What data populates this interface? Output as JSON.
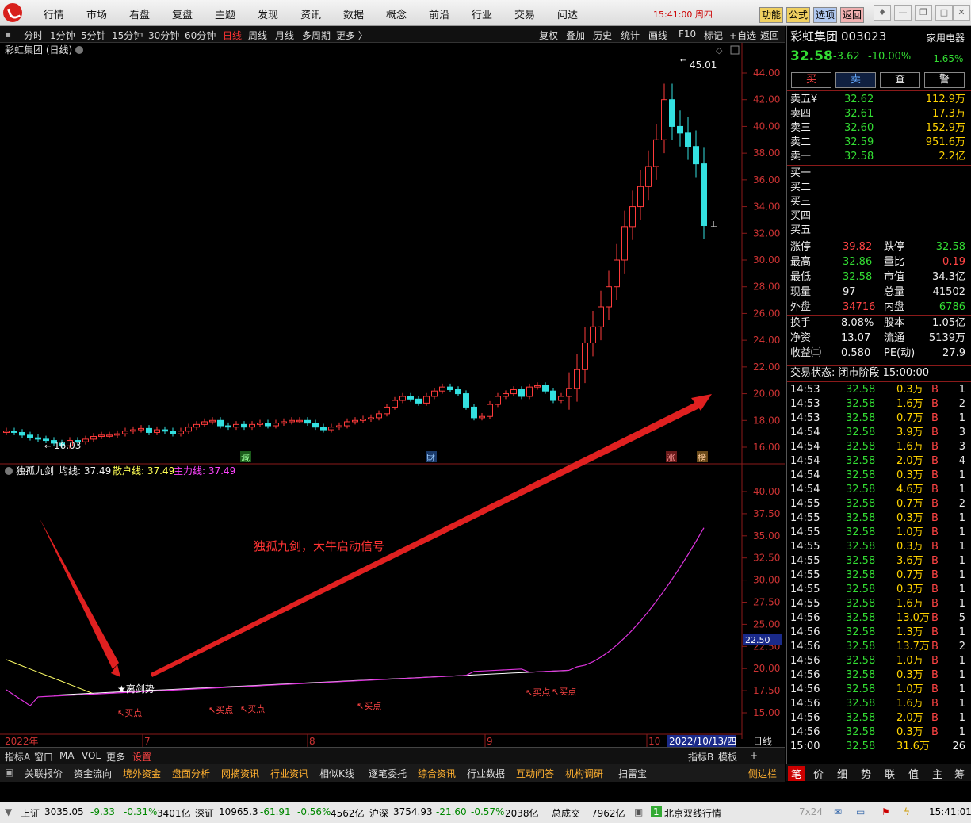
{
  "menu": [
    "行情",
    "市场",
    "看盘",
    "复盘",
    "主题",
    "发现",
    "资讯",
    "数据",
    "概念",
    "前沿",
    "行业",
    "交易",
    "问达"
  ],
  "clock": "15:41:00 周四",
  "top_buttons": [
    "功能",
    "公式",
    "选项",
    "返回"
  ],
  "periods": [
    "分时",
    "1分钟",
    "5分钟",
    "15分钟",
    "30分钟",
    "60分钟",
    "日线",
    "周线",
    "月线",
    "多周期",
    "更多 〉"
  ],
  "tools": [
    "复权",
    "叠加",
    "历史",
    "统计",
    "画线",
    "F10",
    "标记",
    "+自选",
    "返回"
  ],
  "chart": {
    "title": "彩虹集团 (日线)",
    "high_label": "45.01",
    "low_label": "16.03",
    "price_ticks": [
      "44.00",
      "42.00",
      "40.00",
      "38.00",
      "36.00",
      "34.00",
      "32.00",
      "30.00",
      "28.00",
      "26.00",
      "24.00",
      "22.00",
      "20.00",
      "18.00",
      "16.00"
    ],
    "event_markers": [
      "減",
      "財",
      "涨",
      "榜"
    ],
    "indicator_title": "独孤九剑",
    "indicator_legend": "均线: 37.49",
    "indicator_legend2": "散户线: 37.49",
    "indicator_legend3": "主力线: 37.49",
    "ind_ticks": [
      "40.00",
      "37.50",
      "35.00",
      "32.50",
      "30.00",
      "27.50",
      "25.00",
      "22.50",
      "20.00",
      "17.50",
      "15.00"
    ],
    "current_value_tag": "22.50",
    "annotation": "独孤九剑，大牛启动信号",
    "signal_label": "★离剑势",
    "buy_points": [
      "买点",
      "买点",
      "买点",
      "买点",
      "买点",
      "买点"
    ],
    "x_labels": [
      "2022年",
      "7",
      "8",
      "9",
      "10"
    ],
    "date_label": "2022/10/13/四",
    "period_label": "日线"
  },
  "chart_data": {
    "type": "candlestick",
    "title": "彩虹集团 (日线)",
    "high": 45.01,
    "low": 16.03,
    "close_values": [
      17.2,
      17.1,
      16.9,
      16.7,
      16.6,
      16.5,
      16.3,
      16.1,
      16.5,
      16.4,
      16.6,
      16.8,
      16.9,
      16.9,
      17.0,
      17.2,
      17.3,
      17.4,
      17.1,
      17.3,
      17.2,
      17.0,
      17.2,
      17.5,
      17.7,
      17.9,
      18.0,
      17.6,
      17.5,
      17.7,
      17.5,
      17.7,
      17.8,
      17.6,
      17.8,
      17.9,
      18.0,
      18.0,
      17.8,
      17.5,
      17.3,
      17.5,
      17.6,
      17.9,
      18.0,
      18.1,
      18.2,
      18.5,
      19.0,
      19.5,
      19.8,
      19.6,
      19.3,
      19.8,
      20.2,
      20.5,
      20.3,
      20.0,
      19.0,
      18.2,
      18.3,
      19.2,
      19.8,
      20.0,
      20.3,
      19.8,
      20.5,
      20.6,
      20.2,
      19.5,
      19.8,
      20.4,
      21.8,
      23.8,
      25.0,
      26.5,
      28.0,
      30.0,
      32.5,
      34.0,
      35.5,
      37.0,
      39.0,
      42.0,
      40.0,
      39.5,
      38.5,
      37.2,
      32.58
    ],
    "indicator_series": [
      {
        "name": "均线",
        "value": 37.49
      },
      {
        "name": "散户线",
        "value": 37.49
      },
      {
        "name": "主力线",
        "value": 37.49
      }
    ],
    "ylim": [
      15,
      45
    ]
  },
  "quote": {
    "name": "彩虹集团",
    "code": "003023",
    "sector": "家用电器",
    "price": "32.58",
    "change": "-3.62",
    "pct": "-10.00%",
    "sector_pct": "-1.65%",
    "trade_buttons": [
      "买",
      "卖",
      "查",
      "警"
    ],
    "asks": [
      {
        "label": "卖五¥",
        "price": "32.62",
        "vol": "112.9万"
      },
      {
        "label": "卖四",
        "price": "32.61",
        "vol": "17.3万"
      },
      {
        "label": "卖三",
        "price": "32.60",
        "vol": "152.9万"
      },
      {
        "label": "卖二",
        "price": "32.59",
        "vol": "951.6万"
      },
      {
        "label": "卖一",
        "price": "32.58",
        "vol": "2.2亿"
      }
    ],
    "bids": [
      "买一",
      "买二",
      "买三",
      "买四",
      "买五"
    ],
    "stats": [
      {
        "k1": "涨停",
        "v1": "39.82",
        "k2": "跌停",
        "v2": "32.58"
      },
      {
        "k1": "最高",
        "v1": "32.86",
        "k2": "量比",
        "v2": "0.19"
      },
      {
        "k1": "最低",
        "v1": "32.58",
        "k2": "市值",
        "v2": "34.3亿"
      },
      {
        "k1": "现量",
        "v1": "97",
        "k2": "总量",
        "v2": "41502"
      },
      {
        "k1": "外盘",
        "v1": "34716",
        "k2": "内盘",
        "v2": "6786"
      }
    ],
    "stats2": [
      {
        "k1": "换手",
        "v1": "8.08%",
        "k2": "股本",
        "v2": "1.05亿"
      },
      {
        "k1": "净资",
        "v1": "13.07",
        "k2": "流通",
        "v2": "5139万"
      },
      {
        "k1": "收益㈡",
        "v1": "0.580",
        "k2": "PE(动)",
        "v2": "27.9"
      }
    ],
    "trade_status": "交易状态: 闭市阶段 15:00:00",
    "ticks": [
      [
        "14:53",
        "32.58",
        "0.3万",
        "B",
        "1"
      ],
      [
        "14:53",
        "32.58",
        "1.6万",
        "B",
        "2"
      ],
      [
        "14:53",
        "32.58",
        "0.7万",
        "B",
        "1"
      ],
      [
        "14:54",
        "32.58",
        "3.9万",
        "B",
        "3"
      ],
      [
        "14:54",
        "32.58",
        "1.6万",
        "B",
        "3"
      ],
      [
        "14:54",
        "32.58",
        "2.0万",
        "B",
        "4"
      ],
      [
        "14:54",
        "32.58",
        "0.3万",
        "B",
        "1"
      ],
      [
        "14:54",
        "32.58",
        "4.6万",
        "B",
        "1"
      ],
      [
        "14:55",
        "32.58",
        "0.7万",
        "B",
        "2"
      ],
      [
        "14:55",
        "32.58",
        "0.3万",
        "B",
        "1"
      ],
      [
        "14:55",
        "32.58",
        "1.0万",
        "B",
        "1"
      ],
      [
        "14:55",
        "32.58",
        "0.3万",
        "B",
        "1"
      ],
      [
        "14:55",
        "32.58",
        "3.6万",
        "B",
        "1"
      ],
      [
        "14:55",
        "32.58",
        "0.7万",
        "B",
        "1"
      ],
      [
        "14:55",
        "32.58",
        "0.3万",
        "B",
        "1"
      ],
      [
        "14:55",
        "32.58",
        "1.6万",
        "B",
        "1"
      ],
      [
        "14:56",
        "32.58",
        "13.0万",
        "B",
        "5"
      ],
      [
        "14:56",
        "32.58",
        "1.3万",
        "B",
        "1"
      ],
      [
        "14:56",
        "32.58",
        "13.7万",
        "B",
        "2"
      ],
      [
        "14:56",
        "32.58",
        "1.0万",
        "B",
        "1"
      ],
      [
        "14:56",
        "32.58",
        "0.3万",
        "B",
        "1"
      ],
      [
        "14:56",
        "32.58",
        "1.0万",
        "B",
        "1"
      ],
      [
        "14:56",
        "32.58",
        "1.6万",
        "B",
        "1"
      ],
      [
        "14:56",
        "32.58",
        "2.0万",
        "B",
        "1"
      ],
      [
        "14:56",
        "32.58",
        "0.3万",
        "B",
        "1"
      ],
      [
        "15:00",
        "32.58",
        "31.6万",
        "",
        "26"
      ]
    ]
  },
  "bottom_tabs": [
    "指标A",
    "窗口",
    "MA",
    "VOL",
    "更多",
    "设置"
  ],
  "bottom_right": [
    "指标B",
    "模板",
    "+",
    "-"
  ],
  "func_bar": [
    "关联报价",
    "资金流向",
    "境外资金",
    "盘面分析",
    "网摘资讯",
    "行业资讯",
    "相似K线",
    "逐笔委托",
    "综合资讯",
    "行业数据",
    "互动问答",
    "机构调研",
    "扫雷宝"
  ],
  "func_bar_right": "侧边栏",
  "side_tabs": [
    "笔",
    "价",
    "细",
    "势",
    "联",
    "值",
    "主",
    "筹"
  ],
  "status": {
    "sh_name": "上证",
    "sh_val": "3035.05",
    "sh_chg": "-9.33",
    "sh_pct": "-0.31%",
    "sh_amt": "3401亿",
    "sz_name": "深证",
    "sz_val": "10965.3",
    "sz_chg": "-61.91",
    "sz_pct": "-0.56%",
    "sz_amt": "4562亿",
    "hs_name": "沪深",
    "hs_val": "3754.93",
    "hs_chg": "-21.60",
    "hs_pct": "-0.57%",
    "hs_amt": "2038亿",
    "total_label": "总成交",
    "total": "7962亿",
    "feed": "北京双线行情一",
    "time": "15:41:01",
    "mode": "7x24"
  }
}
